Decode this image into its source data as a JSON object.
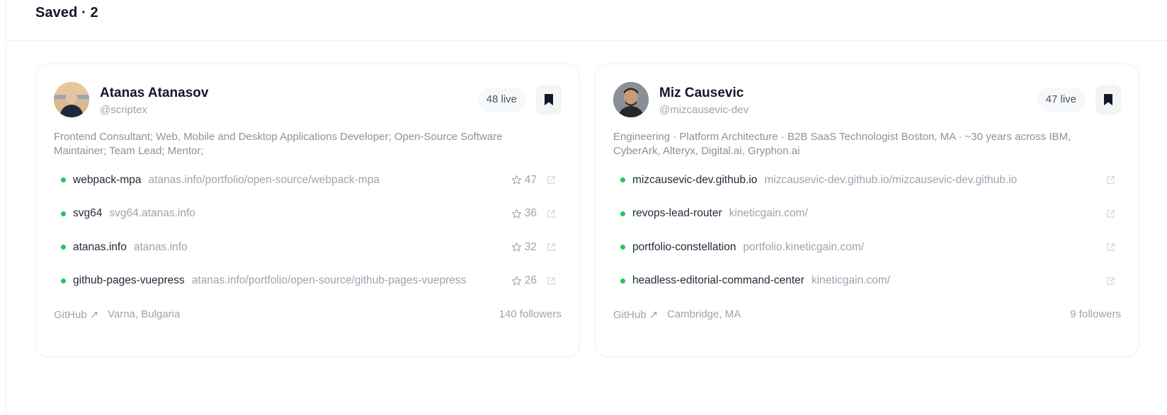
{
  "header": {
    "title": "Saved · 2"
  },
  "colors": {
    "status_dot": "#22c55e",
    "bookmark": "#111827",
    "muted": "#9ca3af"
  },
  "cards": [
    {
      "name": "Atanas Atanasov",
      "handle": "@scriptex",
      "live": "48 live",
      "bio": "Frontend Consultant; Web, Mobile and Desktop Applications Developer; Open-Source Software Maintainer; Team Lead; Mentor;",
      "repos": [
        {
          "name": "webpack-mpa",
          "url": "atanas.info/portfolio/open-source/webpack-mpa",
          "stars": "47"
        },
        {
          "name": "svg64",
          "url": "svg64.atanas.info",
          "stars": "36"
        },
        {
          "name": "atanas.info",
          "url": "atanas.info",
          "stars": "32"
        },
        {
          "name": "github-pages-vuepress",
          "url": "atanas.info/portfolio/open-source/github-pages-vuepress",
          "stars": "26"
        }
      ],
      "link_label": "GitHub ↗",
      "location": "Varna, Bulgaria",
      "followers": "140 followers"
    },
    {
      "name": "Miz Causevic",
      "handle": "@mizcausevic-dev",
      "live": "47 live",
      "bio": "Engineering · Platform Architecture · B2B SaaS Technologist Boston, MA · ~30 years across IBM, CyberArk, Alteryx, Digital.ai, Gryphon.ai",
      "repos": [
        {
          "name": "mizcausevic-dev.github.io",
          "url": "mizcausevic-dev.github.io/mizcausevic-dev.github.io"
        },
        {
          "name": "revops-lead-router",
          "url": "kineticgain.com/"
        },
        {
          "name": "portfolio-constellation",
          "url": "portfolio.kineticgain.com/"
        },
        {
          "name": "headless-editorial-command-center",
          "url": "kineticgain.com/"
        }
      ],
      "link_label": "GitHub ↗",
      "location": "Cambridge, MA",
      "followers": "9 followers"
    }
  ]
}
